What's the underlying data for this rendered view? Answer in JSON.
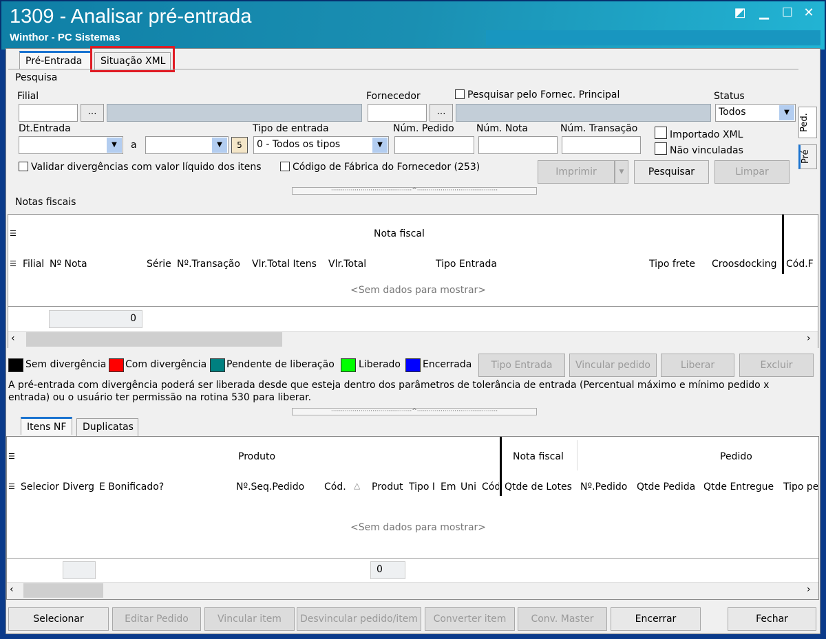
{
  "window": {
    "title": "1309 - Analisar pré-entrada",
    "subtitle": "Winthor - PC Sistemas",
    "controls": [
      "restore-icon",
      "minimize-icon",
      "maximize-icon",
      "close-icon"
    ]
  },
  "tabs": [
    {
      "label": "Pré-Entrada",
      "active": true
    },
    {
      "label": "Situação XML",
      "highlighted": true
    }
  ],
  "side_tabs": [
    "Ped.",
    "Pré"
  ],
  "search": {
    "group": "Pesquisa",
    "filial_label": "Filial",
    "filial_value": "",
    "fornecedor_label": "Fornecedor",
    "fornecedor_value": "",
    "fornec_principal_label": "Pesquisar pelo Fornec. Principal",
    "status_label": "Status",
    "status_value": "Todos",
    "dt_entrada_label": "Dt.Entrada",
    "a_label": "a",
    "tipo_entrada_label": "Tipo de entrada",
    "tipo_entrada_value": "0 - Todos os tipos",
    "num_pedido_label": "Núm. Pedido",
    "num_nota_label": "Núm. Nota",
    "num_transacao_label": "Núm. Transação",
    "importado_xml_label": "Importado XML",
    "nao_vinculadas_label": "Não vinculadas",
    "validar_label": "Validar divergências com valor líquido dos itens",
    "codigo_fabrica_label": "Código de Fábrica do Fornecedor (253)",
    "imprimir": "Imprimir",
    "pesquisar": "Pesquisar",
    "limpar": "Limpar"
  },
  "notas": {
    "group": "Notas fiscais",
    "band": "Nota fiscal",
    "columns": [
      "Filial",
      "Nº Nota",
      "Série",
      "Nº.Transação",
      "Vlr.Total Itens",
      "Vlr.Total",
      "Tipo Entrada",
      "Tipo frete",
      "Croosdocking",
      "Cód.F"
    ],
    "empty": "<Sem dados para mostrar>",
    "total": "0"
  },
  "legend": [
    {
      "label": "Sem divergência",
      "color": "#000000"
    },
    {
      "label": "Com divergência",
      "color": "#ff0000"
    },
    {
      "label": "Pendente de liberação",
      "color": "#008080"
    },
    {
      "label": "Liberado",
      "color": "#00ff00"
    },
    {
      "label": "Encerrada",
      "color": "#0000ff"
    }
  ],
  "notas_buttons": {
    "tipo_entrada": "Tipo Entrada",
    "vincular_pedido": "Vincular pedido",
    "liberar": "Liberar",
    "excluir": "Excluir"
  },
  "info_line1": "A pré-entrada com divergência poderá ser liberada desde que esteja dentro dos parâmetros de tolerância de entrada (Percentual máximo e mínimo pedido x",
  "info_line2": "entrada) ou o usuário ter permissão na rotina 530 para liberar.",
  "sub_tabs": [
    {
      "label": "Itens NF",
      "active": true
    },
    {
      "label": "Duplicatas"
    }
  ],
  "itens": {
    "bands": [
      "Produto",
      "Nota fiscal",
      "Pedido"
    ],
    "columns": [
      "Selecior",
      "Diverg",
      "E Bonificado?",
      "Nº.Seq.Pedido",
      "Cód.",
      "Produt",
      "Tipo I",
      "Em",
      "Uni",
      "Cód",
      "Qtde de Lotes",
      "Nº.Pedido",
      "Qtde Pedida",
      "Qtde Entregue",
      "Tipo pe"
    ],
    "sort_indicator": "△",
    "empty": "<Sem dados para mostrar>",
    "total": "0"
  },
  "bottom_buttons": [
    "Selecionar",
    "Editar Pedido",
    "Vincular item",
    "Desvincular pedido/item",
    "Converter item",
    "Conv. Master",
    "Encerrar",
    "Fechar"
  ]
}
